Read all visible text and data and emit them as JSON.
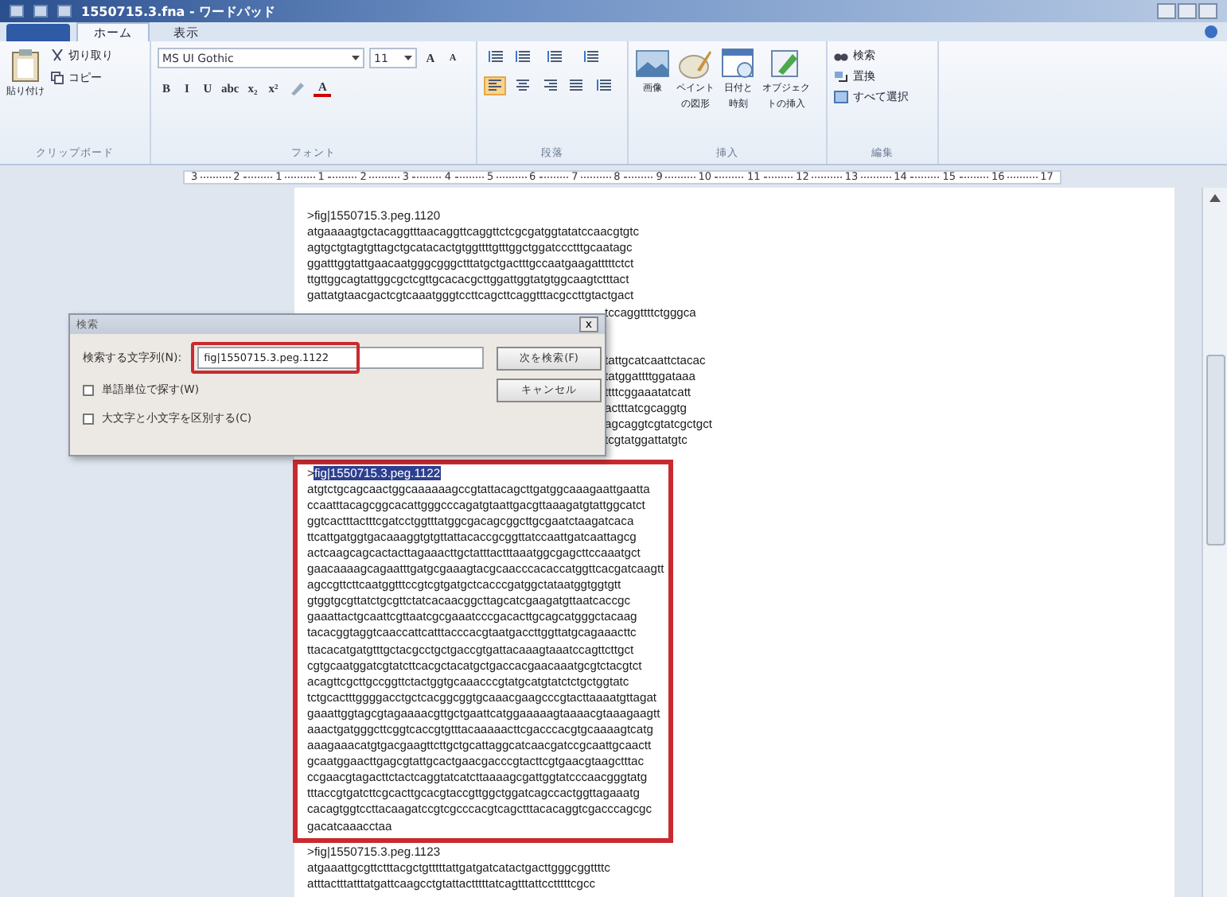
{
  "window": {
    "title": "1550715.3.fna - ワードパッド"
  },
  "ribbon_tabs": [
    {
      "label": "ホーム",
      "selected": true
    },
    {
      "label": "表示",
      "selected": false
    }
  ],
  "clipboard": {
    "paste": "貼り付け",
    "cut": "切り取り",
    "copy": "コピー",
    "label": "クリップボード"
  },
  "font": {
    "family": "MS UI Gothic",
    "size": "11",
    "grow": "A",
    "shrink": "A",
    "format_buttons": [
      "B",
      "I",
      "U",
      "abc",
      "x₂",
      "x²"
    ],
    "color_button": "A",
    "label": "フォント"
  },
  "paragraph": {
    "alignments": [
      {
        "kind": "left",
        "selected": true
      },
      {
        "kind": "center",
        "selected": false
      },
      {
        "kind": "right",
        "selected": false
      },
      {
        "kind": "justify",
        "selected": false
      }
    ],
    "label": "段落"
  },
  "insert": {
    "items": [
      {
        "kind": "image",
        "lines": [
          "画像"
        ]
      },
      {
        "kind": "paint",
        "lines": [
          "ペイント",
          "の図形"
        ]
      },
      {
        "kind": "date",
        "lines": [
          "日付と",
          "時刻"
        ]
      },
      {
        "kind": "object",
        "lines": [
          "オブジェク",
          "トの挿入"
        ]
      }
    ],
    "label": "挿入"
  },
  "edit": {
    "items": [
      {
        "kind": "find",
        "label": "検索"
      },
      {
        "kind": "replace",
        "label": "置換"
      },
      {
        "kind": "select_all",
        "label": "すべて選択"
      }
    ],
    "label": "編集"
  },
  "ruler": {
    "marks": [
      "3",
      "2",
      "1",
      "1",
      "2",
      "3",
      "4",
      "5",
      "6",
      "7",
      "8",
      "9",
      "10",
      "11",
      "12",
      "13",
      "14",
      "15",
      "16",
      "17"
    ]
  },
  "document": {
    "blocks": [
      {
        "header": {
          "marker": ">",
          "name": "fig|1550715.3.peg.1120",
          "selected": false
        },
        "lines": [
          "atgaaaagtgctacaggtttaacaggttcaggttctcgcgatggtatatccaacgtgtc",
          "agtgctgtagtgttagctgcatacactgtggttttgtttggctggatccctttgcaatagc",
          "ggatttggtattgaacaatgggcgggctttatgctgactttgccaatgaagatttttctct",
          "ttgttggcagtattggcgctcgttgcacacgcttggattggtatgtggcaagtctttact",
          "gattatgtaacgactcgtcaaatgggtccttcagcttcaggtttacgccttgtactgact"
        ],
        "tails": [
          "tccaggttttctgggca",
          "tattgcatcaattctacac",
          "tatggattttggataaa",
          "ttttcggaaatatcatt",
          "actttatcgcaggtg",
          "agcaggtcgtatcgctgct",
          "tcgtatggattatgtc"
        ]
      },
      {
        "header": {
          "marker": ">",
          "name": "fig|1550715.3.peg.1122",
          "selected": true
        },
        "framed": true,
        "lines": [
          "atgtctgcagcaactggcaaaaaagccgtattacagcttgatggcaaagaattgaatta",
          "ccaatttacagcggcacattgggcccagatgtaattgacgttaaagatgtattggcatct",
          "ggtcactttactttcgatcctggtttatggcgacagcggcttgcgaatctaagatcaca",
          "ttcattgatggtgacaaaggtgtgttattacaccgcggttatccaattgatcaattagcg",
          "actcaagcagcactacttagaaacttgctatttactttaaatggcgagcttccaaatgct",
          "gaacaaaagcagaatttgatgcgaaagtacgcaacccacaccatggttcacgatcaagtt",
          "agccgttcttcaatggtttccgtcgtgatgctcacccgatggctataatggtggtgtt",
          "gtggtgcgttatctgcgttctatcacaacggcttagcatcgaagatgttaatcaccgc",
          "gaaattactgcaattcgttaatcgcgaaatcccgacacttgcagcatgggctacaag",
          "tacacggtaggtcaaccattcatttacccacgtaatgaccttggttatgcagaaacttc",
          "ttacacatgatgtttgctacgcctgctgaccgtgattacaaagtaaatccagttcttgct",
          "cgtgcaatggatcgtatcttcacgctacatgctgaccacgaacaaatgcgtctacgtct",
          "acagttcgcttgccggttctactggtgcaaacccgtatgcatgtatctctgctggtatc",
          "tctgcactttggggacctgctcacggcggtgcaaacgaagcccgtacttaaaatgttagat",
          "gaaattggtagcgtagaaaacgttgctgaattcatggaaaaagtaaaacgtaaagaagtt",
          "aaactgatgggcttcggtcaccgtgtttacaaaaacttcgacccacgtgcaaaagtcatg",
          "aaagaaacatgtgacgaagttcttgctgcattaggcatcaacgatccgcaattgcaactt",
          "gcaatggaacttgagcgtattgcactgaacgacccgtacttcgtgaacgtaagctttac",
          "ccgaacgtagacttctactcaggtatcatcttaaaagcgattggtatcccaacgggtatg",
          "tttaccgtgatcttcgcacttgcacgtaccgttggctggatcagccactggttagaaatg",
          "cacagtggtccttacaagatccgtcgcccacgtcagctttacacaggtcgacccagcgc",
          "gacatcaaacctaa"
        ]
      },
      {
        "header": {
          "marker": ">",
          "name": "fig|1550715.3.peg.1123",
          "selected": false
        },
        "lines": [
          "atgaaattgcgttctttacgctgtttttattgatgatcatactgacttgggcggttttc",
          "atttactttatttatgattcaagcctgtattactttttatcagtttattcctttttcgcc"
        ]
      }
    ]
  },
  "find_dialog": {
    "title": "検索",
    "close": "x",
    "find_label": "検索する文字列(N):",
    "find_value": "fig|1550715.3.peg.1122",
    "find_next": "次を検索(F)",
    "cancel": "キャンセル",
    "options": [
      {
        "label": "単語単位で探す(W)",
        "checked": false
      },
      {
        "label": "大文字と小文字を区別する(C)",
        "checked": false
      }
    ]
  }
}
